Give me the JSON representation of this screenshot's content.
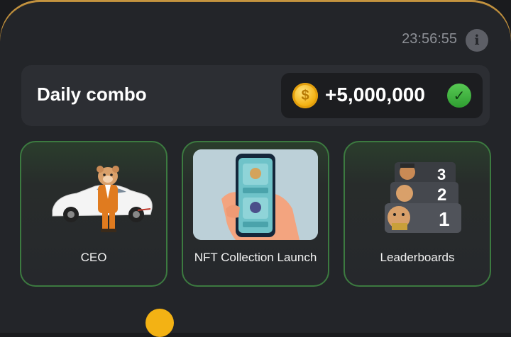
{
  "timer": "23:56:55",
  "info_icon": "i",
  "daily_combo": {
    "title": "Daily combo",
    "reward": "+5,000,000",
    "reward_icon": "coin-icon",
    "status_icon": "check-icon"
  },
  "cards": [
    {
      "label": "CEO",
      "image": "hamster-ceo-car-illustration"
    },
    {
      "label": "NFT Collection Launch",
      "image": "nft-phone-illustration"
    },
    {
      "label": "Leaderboards",
      "image": "leaderboard-ranking-illustration",
      "ranks": [
        "3",
        "2",
        "1"
      ]
    }
  ],
  "colors": {
    "accent_gold": "#c49440",
    "success_green": "#3c7a40",
    "background": "#232529"
  }
}
